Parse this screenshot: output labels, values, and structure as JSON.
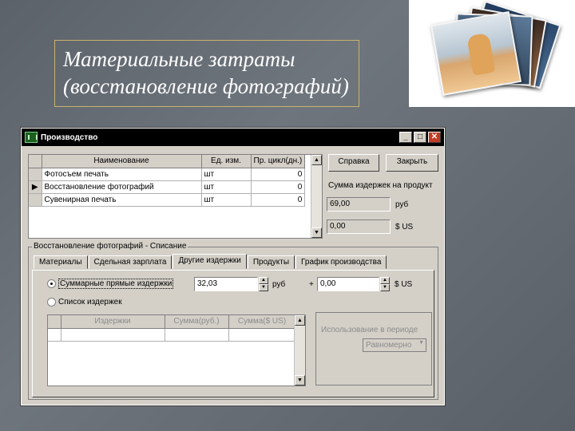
{
  "slide": {
    "title_line1": "Материальные затраты",
    "title_line2": "(восстановление фотографий)"
  },
  "window": {
    "title": "Производство",
    "controls": {
      "minimize": "_",
      "maximize": "□",
      "close": "✕"
    }
  },
  "products_table": {
    "headers": [
      "Наименование",
      "Ед. изм.",
      "Пр. цикл(дн.)"
    ],
    "rows": [
      {
        "name": "Фотосъем печать",
        "unit": "шт",
        "cycle": "0"
      },
      {
        "name": "Восстановление фотографий",
        "unit": "шт",
        "cycle": "0"
      },
      {
        "name": "Сувенирная печать",
        "unit": "шт",
        "cycle": "0"
      }
    ],
    "current_row_marker": "▶"
  },
  "buttons": {
    "help": "Справка",
    "close": "Закрыть"
  },
  "summary": {
    "label": "Сумма издержек на продукт",
    "rub_value": "69,00",
    "rub_unit": "руб",
    "usd_value": "0,00",
    "usd_unit": "$ US"
  },
  "group": {
    "title": "Восстановление фотографий - Списание",
    "tabs": [
      "Материалы",
      "Сдельная зарплата",
      "Другие издержки",
      "Продукты",
      "График производства"
    ],
    "active_tab": "Другие издержки"
  },
  "costs": {
    "option_sum_label": "Суммарные прямые издержки",
    "option_list_label": "Список издержек",
    "sum_value": "32,03",
    "sum_unit": "руб",
    "plus": "+",
    "usd_value": "0,00",
    "usd_unit": "$ US"
  },
  "costs_table": {
    "headers": [
      "Издержки",
      "Сумма(руб.)",
      "Сумма($ US)"
    ]
  },
  "distribution": {
    "label": "Использование в периоде",
    "selected": "Равномерно"
  }
}
